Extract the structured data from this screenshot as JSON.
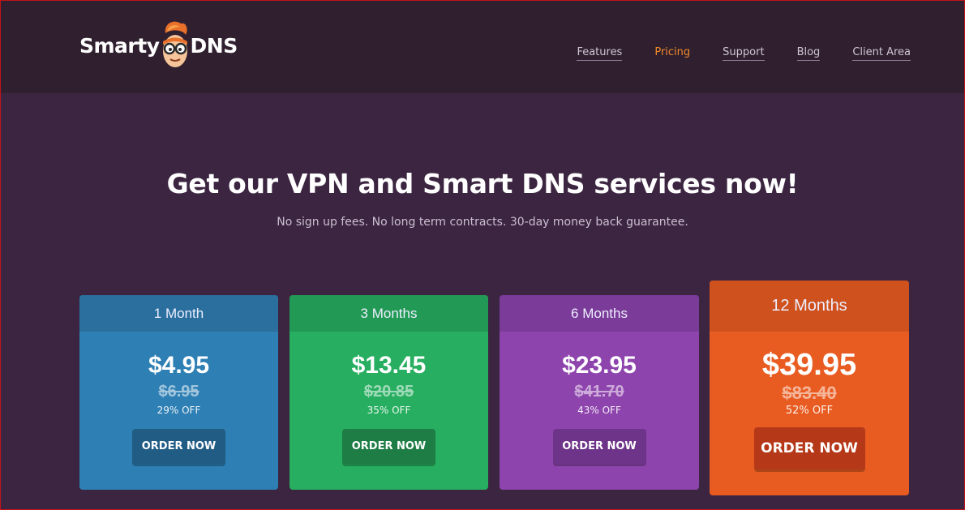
{
  "brand": {
    "left": "Smarty",
    "right": "DNS"
  },
  "nav": {
    "items": [
      "Features",
      "Pricing",
      "Support",
      "Blog",
      "Client Area"
    ],
    "active": "Pricing"
  },
  "hero": {
    "title": "Get our VPN and Smart DNS services now!",
    "subtitle": "No sign up fees. No long term contracts. 30-day money back guarantee."
  },
  "plans": [
    {
      "name": "1 Month",
      "price": "$4.95",
      "old_price": "$6.95",
      "discount": "29% OFF",
      "cta": "ORDER NOW",
      "color": "#2e7fb4"
    },
    {
      "name": "3 Months",
      "price": "$13.45",
      "old_price": "$20.85",
      "discount": "35% OFF",
      "cta": "ORDER NOW",
      "color": "#27ae60"
    },
    {
      "name": "6 Months",
      "price": "$23.95",
      "old_price": "$41.70",
      "discount": "43% OFF",
      "cta": "ORDER NOW",
      "color": "#8e44ad"
    },
    {
      "name": "12 Months",
      "price": "$39.95",
      "old_price": "$83.40",
      "discount": "52% OFF",
      "cta": "ORDER NOW",
      "color": "#e95c21"
    }
  ],
  "colors": {
    "background": "#3c2541",
    "topbar": "#30202f",
    "accent": "#f0882a"
  }
}
